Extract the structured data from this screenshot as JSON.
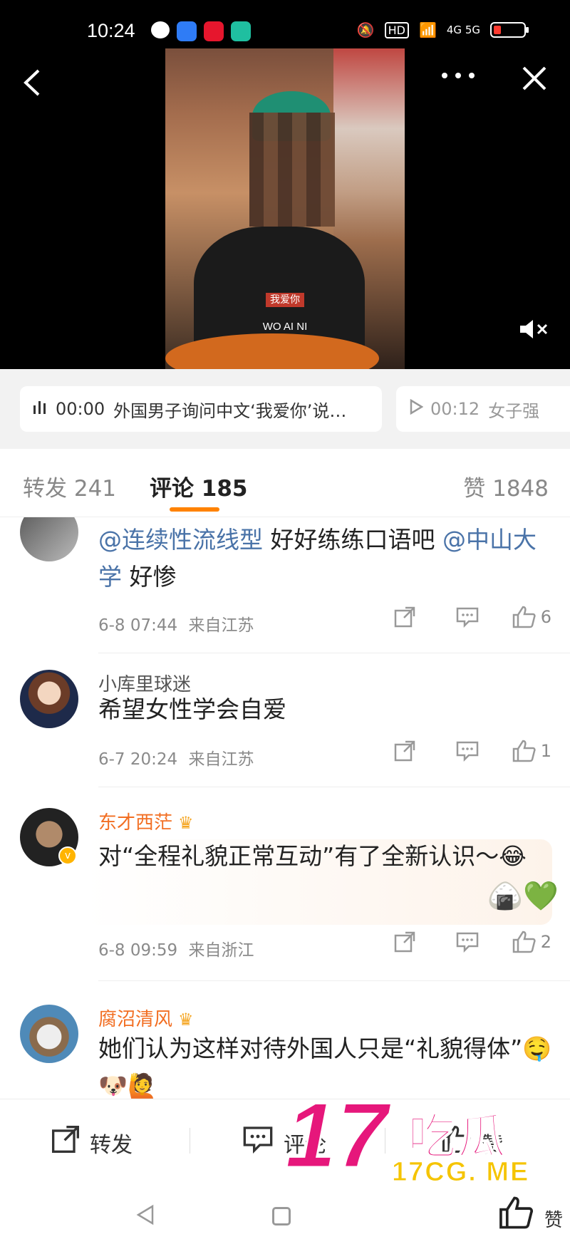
{
  "status_bar": {
    "time": "10:24",
    "hd_label": "HD",
    "network_label": "4G 5G"
  },
  "video": {
    "subtitle_cn": "我爱你",
    "subtitle_pinyin": "WO AI NI"
  },
  "chapters": [
    {
      "time": "00:00",
      "title": "外国男子询问中文‘我爱你’说…",
      "icon": "audio-bars-icon"
    },
    {
      "time": "00:12",
      "title": "女子强",
      "icon": "play-icon"
    }
  ],
  "tabs": {
    "repost": "转发 241",
    "comment": "评论 185",
    "like": "赞 1848",
    "active": "comment",
    "accent_color": "#ff8200"
  },
  "comments": [
    {
      "username": "",
      "mention1": "@连续性流线型",
      "text_middle": " 好好练练口语吧 ",
      "mention2": "@中山大学",
      "text_end": " 好惨",
      "time": "6-8 07:44",
      "location": "来自江苏",
      "likes": "6"
    },
    {
      "username": "小库里球迷",
      "text": "希望女性学会自爱",
      "time": "6-7 20:24",
      "location": "来自江苏",
      "likes": "1"
    },
    {
      "username": "东才西茫",
      "vip": true,
      "text": "对“全程礼貌正常互动”有了全新认识～😂",
      "time": "6-8 09:59",
      "location": "来自浙江",
      "likes": "2"
    },
    {
      "username": "腐沼清风",
      "vip": true,
      "text": "她们认为这样对待外国人只是“礼貌得体”🤤🐶🙋"
    }
  ],
  "bottom_bar": {
    "repost": "转发",
    "comment": "评论",
    "like": "赞"
  },
  "nav": {
    "like_label": "赞"
  },
  "watermark": {
    "big": "17",
    "cn": "吃瓜",
    "url": "17CG. ME"
  }
}
